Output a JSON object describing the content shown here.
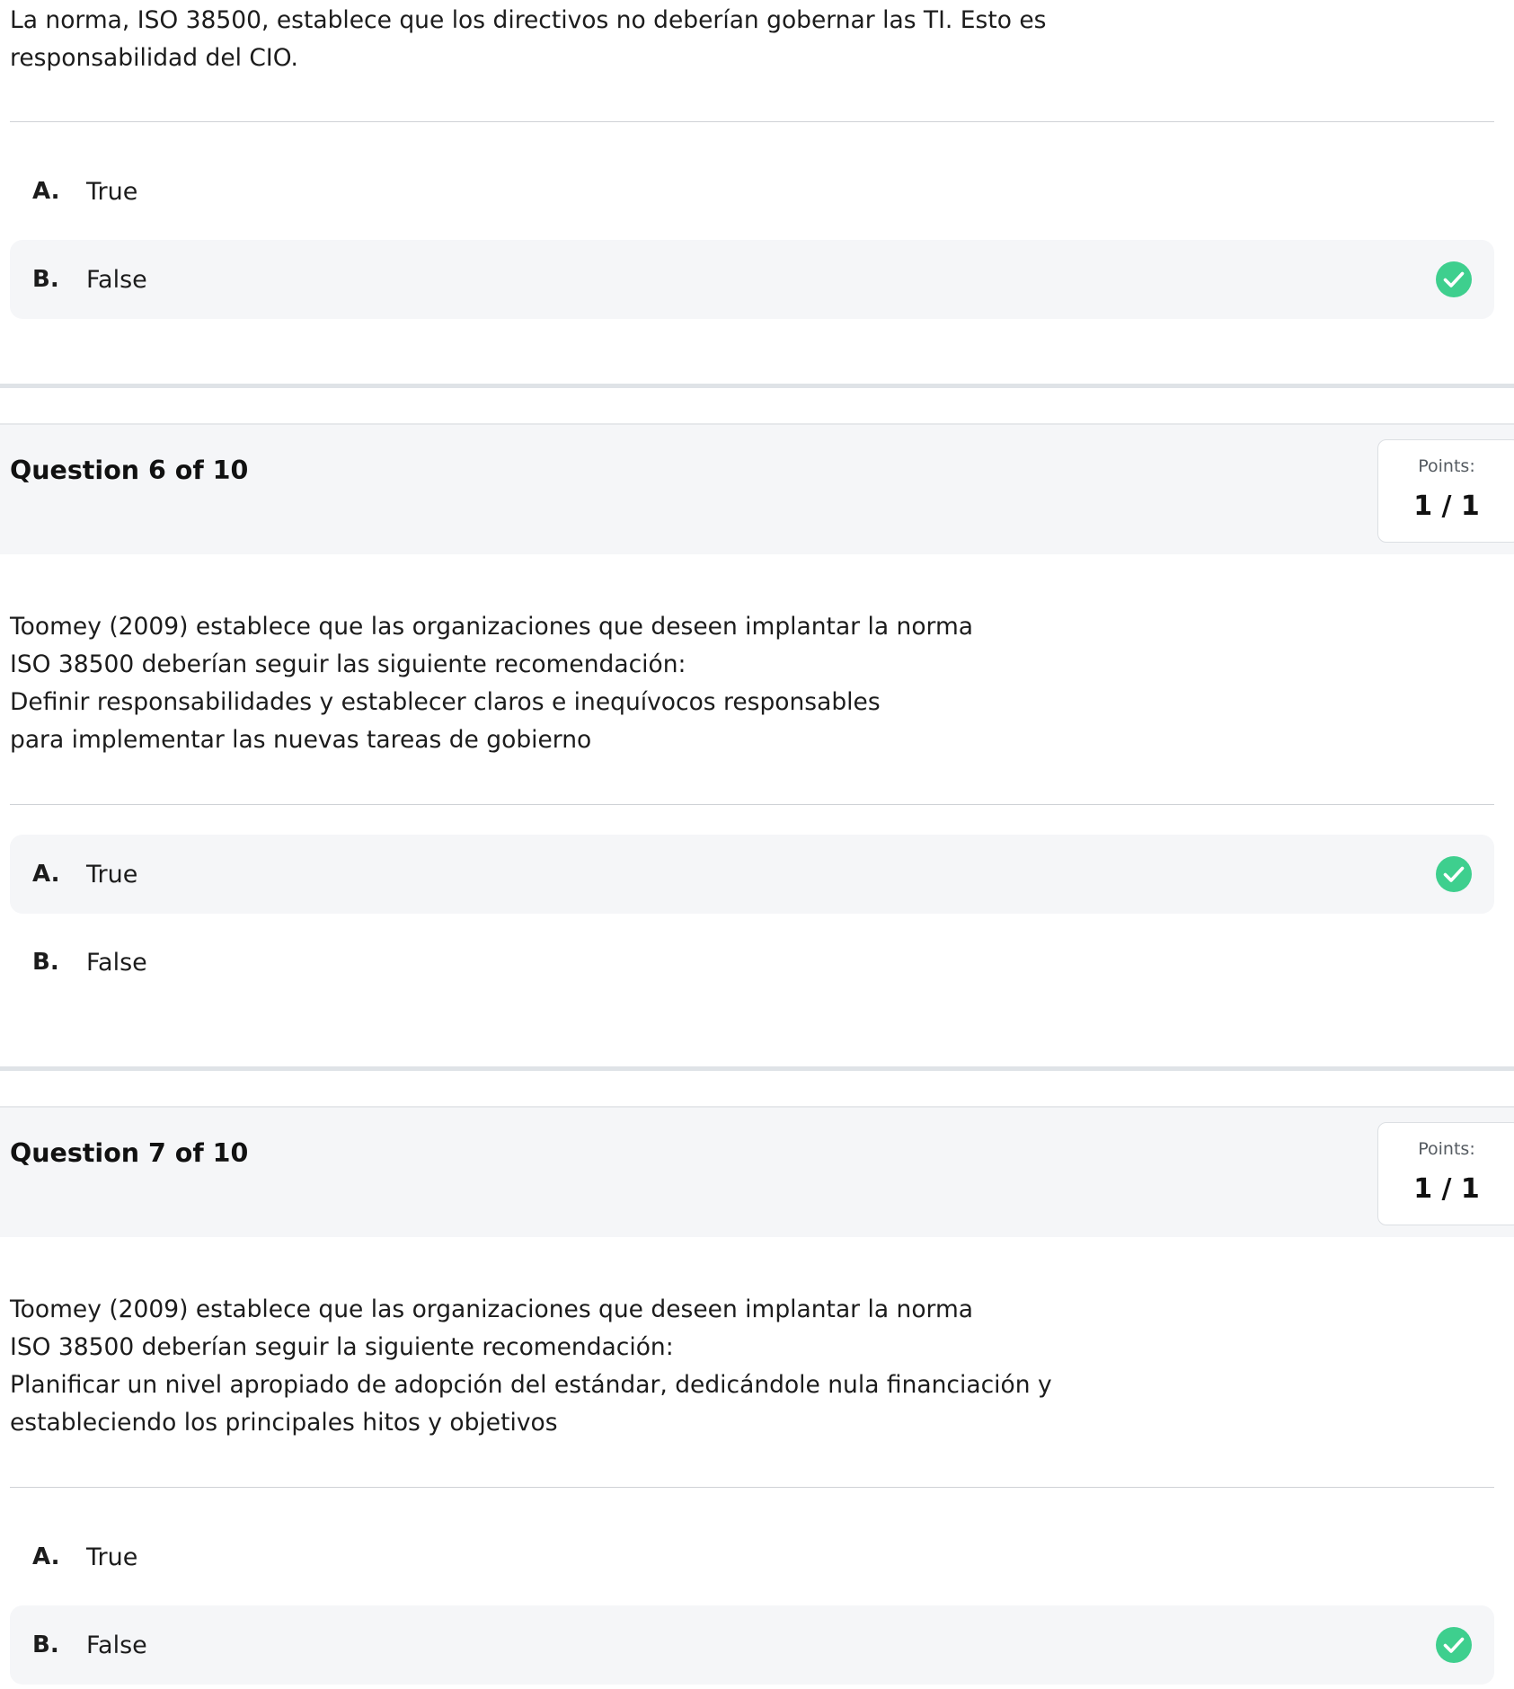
{
  "questions": [
    {
      "text": "La norma, ISO 38500, establece que los directivos no deberían gobernar las TI. Esto es\nresponsabilidad del CIO.",
      "options": [
        {
          "letter": "A.",
          "label": "True",
          "correct": false
        },
        {
          "letter": "B.",
          "label": "False",
          "correct": true
        }
      ]
    },
    {
      "title": "Question 6 of 10",
      "points_label": "Points:",
      "points_value": "1 / 1",
      "text": "Toomey (2009) establece que las organizaciones que deseen implantar la norma\nISO 38500 deberían seguir las siguiente recomendación:\nDefinir responsabilidades y establecer claros e inequívocos responsables\npara implementar las nuevas tareas de gobierno",
      "options": [
        {
          "letter": "A.",
          "label": "True",
          "correct": true
        },
        {
          "letter": "B.",
          "label": "False",
          "correct": false
        }
      ]
    },
    {
      "title": "Question 7 of 10",
      "points_label": "Points:",
      "points_value": "1 / 1",
      "text": "Toomey (2009) establece que las organizaciones que deseen implantar la norma\nISO 38500 deberían seguir la siguiente recomendación:\nPlanificar un nivel apropiado de adopción del estándar, dedicándole nula financiación y\nestableciendo los principales hitos y objetivos",
      "options": [
        {
          "letter": "A.",
          "label": "True",
          "correct": false
        },
        {
          "letter": "B.",
          "label": "False",
          "correct": true
        }
      ]
    }
  ],
  "icons": {
    "correct": "check-circle-icon"
  },
  "colors": {
    "correct_green": "#3ecf8e",
    "selected_bg": "#f5f6f8",
    "header_bg": "#f5f6f8"
  }
}
